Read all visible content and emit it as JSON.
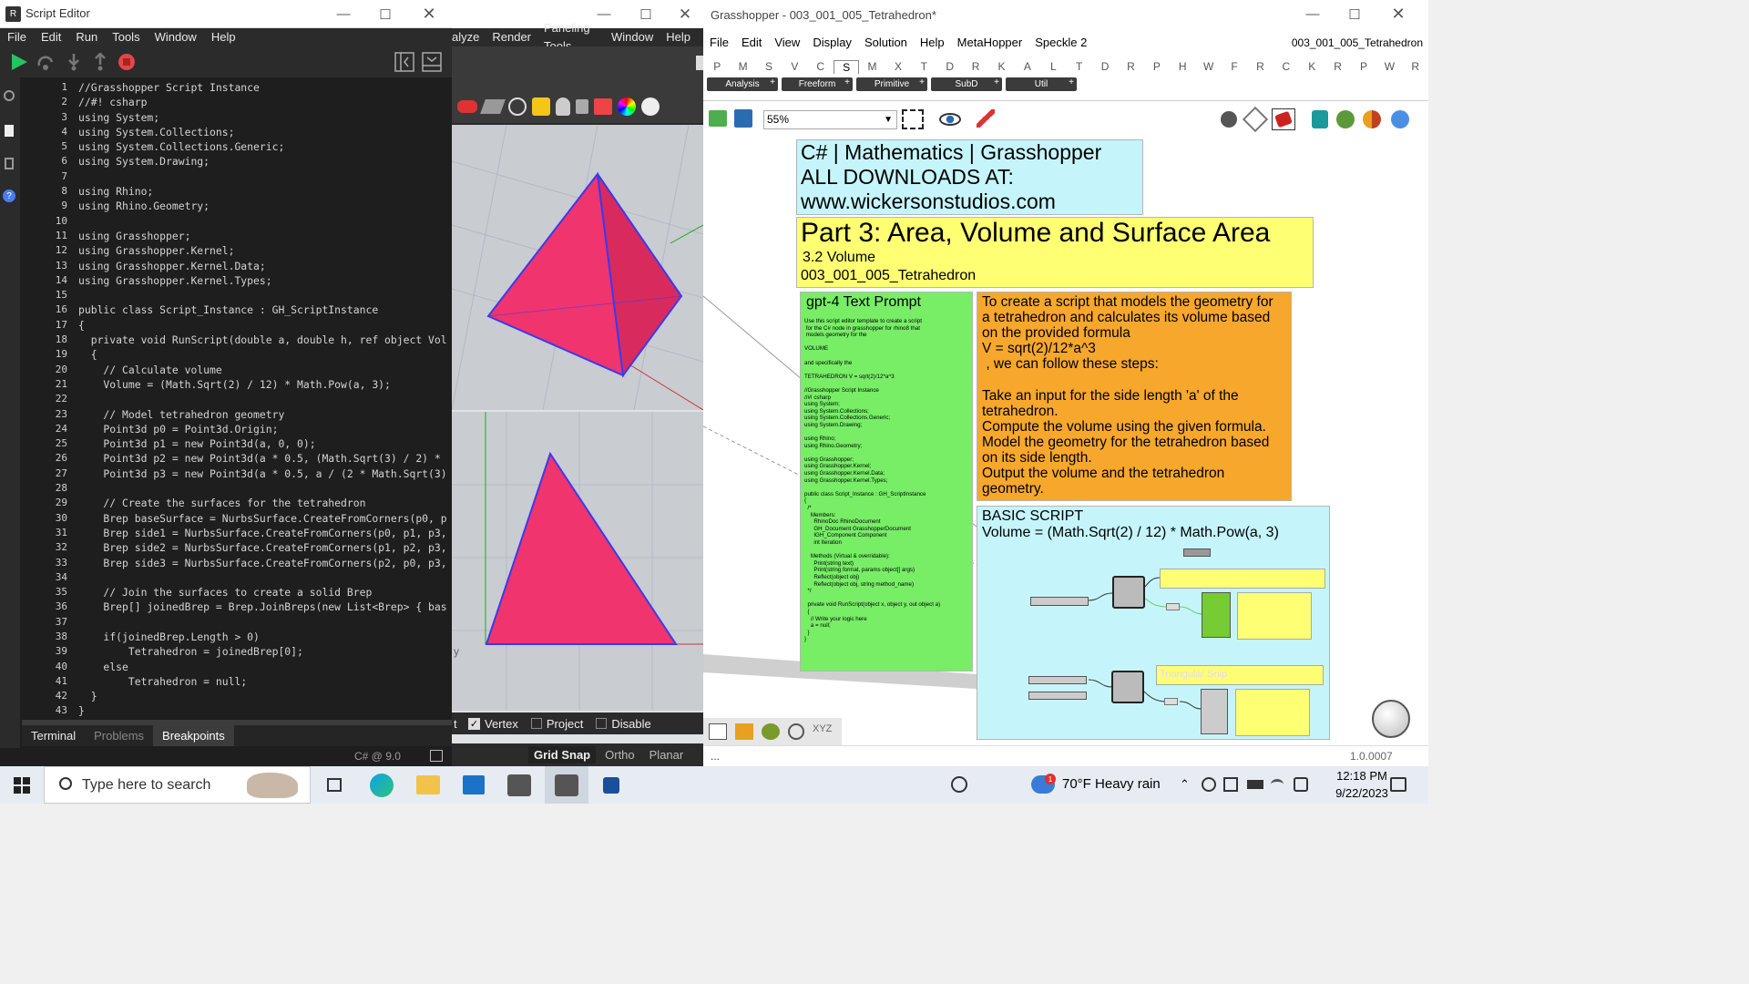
{
  "script_editor": {
    "title": "Script Editor",
    "menu": [
      "File",
      "Edit",
      "Run",
      "Tools",
      "Window",
      "Help"
    ],
    "line_numbers": [
      "1",
      "2",
      "3",
      "4",
      "5",
      "6",
      "7",
      "8",
      "9",
      "10",
      "11",
      "12",
      "13",
      "14",
      "15",
      "16",
      "17",
      "18",
      "19",
      "20",
      "21",
      "22",
      "23",
      "24",
      "25",
      "26",
      "27",
      "28",
      "29",
      "30",
      "31",
      "32",
      "33",
      "34",
      "35",
      "36",
      "37",
      "38",
      "39",
      "40",
      "41",
      "42",
      "43"
    ],
    "code_lines": [
      "//Grasshopper Script Instance",
      "//#! csharp",
      "using System;",
      "using System.Collections;",
      "using System.Collections.Generic;",
      "using System.Drawing;",
      "",
      "using Rhino;",
      "using Rhino.Geometry;",
      "",
      "using Grasshopper;",
      "using Grasshopper.Kernel;",
      "using Grasshopper.Kernel.Data;",
      "using Grasshopper.Kernel.Types;",
      "",
      "public class Script_Instance : GH_ScriptInstance",
      "{",
      "  private void RunScript(double a, double h, ref object Vol",
      "  {",
      "    // Calculate volume",
      "    Volume = (Math.Sqrt(2) / 12) * Math.Pow(a, 3);",
      "",
      "    // Model tetrahedron geometry",
      "    Point3d p0 = Point3d.Origin;",
      "    Point3d p1 = new Point3d(a, 0, 0);",
      "    Point3d p2 = new Point3d(a * 0.5, (Math.Sqrt(3) / 2) *",
      "    Point3d p3 = new Point3d(a * 0.5, a / (2 * Math.Sqrt(3)",
      "",
      "    // Create the surfaces for the tetrahedron",
      "    Brep baseSurface = NurbsSurface.CreateFromCorners(p0, p",
      "    Brep side1 = NurbsSurface.CreateFromCorners(p0, p1, p3,",
      "    Brep side2 = NurbsSurface.CreateFromCorners(p1, p2, p3,",
      "    Brep side3 = NurbsSurface.CreateFromCorners(p2, p0, p3,",
      "",
      "    // Join the surfaces to create a solid Brep",
      "    Brep[] joinedBrep = Brep.JoinBreps(new List<Brep> { bas",
      "",
      "    if(joinedBrep.Length > 0)",
      "        Tetrahedron = joinedBrep[0];",
      "    else",
      "        Tetrahedron = null;",
      "  }",
      "}"
    ],
    "bottom_tabs": [
      "Terminal",
      "Problems",
      "Breakpoints"
    ],
    "status": "C# @ 9.0"
  },
  "rhino": {
    "menu": [
      "alyze",
      "Render",
      "Paneling Tools",
      "Window",
      "Help"
    ],
    "axis_label": "y",
    "osnap": {
      "vertex": "Vertex",
      "project": "Project",
      "disable": "Disable"
    },
    "snap": {
      "grid_snap": "Grid Snap",
      "ortho": "Ortho",
      "planar": "Planar"
    },
    "shape_color": "#f0346d",
    "edge_color": "#3a3aee"
  },
  "grasshopper": {
    "title": "Grasshopper - 003_001_005_Tetrahedron*",
    "menu": [
      "File",
      "Edit",
      "View",
      "Display",
      "Solution",
      "Help",
      "MetaHopper",
      "Speckle 2"
    ],
    "doc_name": "003_001_005_Tetrahedron",
    "tabs": [
      "P",
      "M",
      "S",
      "V",
      "C",
      "S",
      "M",
      "X",
      "T",
      "D",
      "R",
      "K",
      "A",
      "L",
      "T",
      "D",
      "R",
      "P",
      "H",
      "W",
      "F",
      "R",
      "C",
      "K",
      "R",
      "P",
      "W",
      "R"
    ],
    "subtabs": [
      "Analysis",
      "Freeform",
      "Primitive",
      "SubD",
      "Util"
    ],
    "zoom": "55%",
    "panel_downloads": [
      "C# | Mathematics | Grasshopper",
      "ALL DOWNLOADS AT:",
      "www.wickersonstudios.com"
    ],
    "panel_part": {
      "title": "Part 3: Area, Volume and Surface Area",
      "sub1": "3.2 Volume",
      "sub2": "003_001_005_Tetrahedron"
    },
    "panel_gpt": {
      "title": "gpt-4 Text Prompt",
      "body": "Use this script editor template to create a script\n for the C# node in grasshopper for rhino8 that\n models geometry for the\n\nVOLUME\n\nand specifically the\n\nTETRAHEDRON V = sqrt(2)/12*a^3\n\n//Grasshopper Script Instance\n//#! csharp\nusing System;\nusing System.Collections;\nusing System.Collections.Generic;\nusing System.Drawing;\n\nusing Rhino;\nusing Rhino.Geometry;\n\nusing Grasshopper;\nusing Grasshopper.Kernel;\nusing Grasshopper.Kernel.Data;\nusing Grasshopper.Kernel.Types;\n\npublic class Script_Instance : GH_ScriptInstance\n{\n  /*\n    Members:\n      RhinoDoc RhinoDocument\n      GH_Document GrasshopperDocument\n      IGH_Component Component\n      int Iteration\n\n    Methods (Virtual & overridable):\n      Print(string text)\n      Print(string format, params object[] args)\n      Reflect(object obj)\n      Reflect(object obj, string method_name)\n  */\n\n  private void RunScript(object x, object y, out object a)\n  {\n    // Write your logic here\n    a = null;\n  }\n}"
    },
    "panel_steps": "To create a script that models the geometry for\na tetrahedron and calculates its volume based\non the provided formula\nV = sqrt(2)/12*a^3\n , we can follow these steps:\n\nTake an input for the side length 'a' of the\ntetrahedron.\nCompute the volume using the given formula.\nModel the geometry for the tetrahedron based\non its side length.\nOutput the volume and the tetrahedron\ngeometry.",
    "panel_basic": {
      "title": "BASIC SCRIPT",
      "formula": "Volume = (Math.Sqrt(2) / 12) * Math.Pow(a, 3)",
      "group_label": "Triangular Snip"
    },
    "status_left": "...",
    "version": "1.0.0007"
  },
  "taskbar": {
    "search_placeholder": "Type here to search",
    "weather": "70°F  Heavy rain",
    "weather_badge": "1",
    "time": "12:18 PM",
    "date": "9/22/2023"
  }
}
